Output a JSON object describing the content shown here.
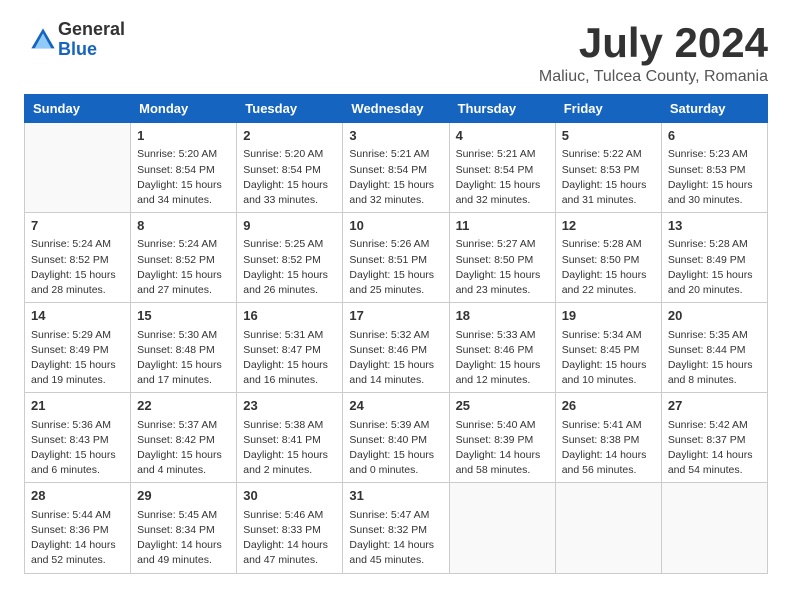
{
  "logo": {
    "general": "General",
    "blue": "Blue"
  },
  "title": "July 2024",
  "subtitle": "Maliuc, Tulcea County, Romania",
  "days_of_week": [
    "Sunday",
    "Monday",
    "Tuesday",
    "Wednesday",
    "Thursday",
    "Friday",
    "Saturday"
  ],
  "weeks": [
    [
      {
        "day": "",
        "sunrise": "",
        "sunset": "",
        "daylight": ""
      },
      {
        "day": "1",
        "sunrise": "Sunrise: 5:20 AM",
        "sunset": "Sunset: 8:54 PM",
        "daylight": "Daylight: 15 hours and 34 minutes."
      },
      {
        "day": "2",
        "sunrise": "Sunrise: 5:20 AM",
        "sunset": "Sunset: 8:54 PM",
        "daylight": "Daylight: 15 hours and 33 minutes."
      },
      {
        "day": "3",
        "sunrise": "Sunrise: 5:21 AM",
        "sunset": "Sunset: 8:54 PM",
        "daylight": "Daylight: 15 hours and 32 minutes."
      },
      {
        "day": "4",
        "sunrise": "Sunrise: 5:21 AM",
        "sunset": "Sunset: 8:54 PM",
        "daylight": "Daylight: 15 hours and 32 minutes."
      },
      {
        "day": "5",
        "sunrise": "Sunrise: 5:22 AM",
        "sunset": "Sunset: 8:53 PM",
        "daylight": "Daylight: 15 hours and 31 minutes."
      },
      {
        "day": "6",
        "sunrise": "Sunrise: 5:23 AM",
        "sunset": "Sunset: 8:53 PM",
        "daylight": "Daylight: 15 hours and 30 minutes."
      }
    ],
    [
      {
        "day": "7",
        "sunrise": "Sunrise: 5:24 AM",
        "sunset": "Sunset: 8:52 PM",
        "daylight": "Daylight: 15 hours and 28 minutes."
      },
      {
        "day": "8",
        "sunrise": "Sunrise: 5:24 AM",
        "sunset": "Sunset: 8:52 PM",
        "daylight": "Daylight: 15 hours and 27 minutes."
      },
      {
        "day": "9",
        "sunrise": "Sunrise: 5:25 AM",
        "sunset": "Sunset: 8:52 PM",
        "daylight": "Daylight: 15 hours and 26 minutes."
      },
      {
        "day": "10",
        "sunrise": "Sunrise: 5:26 AM",
        "sunset": "Sunset: 8:51 PM",
        "daylight": "Daylight: 15 hours and 25 minutes."
      },
      {
        "day": "11",
        "sunrise": "Sunrise: 5:27 AM",
        "sunset": "Sunset: 8:50 PM",
        "daylight": "Daylight: 15 hours and 23 minutes."
      },
      {
        "day": "12",
        "sunrise": "Sunrise: 5:28 AM",
        "sunset": "Sunset: 8:50 PM",
        "daylight": "Daylight: 15 hours and 22 minutes."
      },
      {
        "day": "13",
        "sunrise": "Sunrise: 5:28 AM",
        "sunset": "Sunset: 8:49 PM",
        "daylight": "Daylight: 15 hours and 20 minutes."
      }
    ],
    [
      {
        "day": "14",
        "sunrise": "Sunrise: 5:29 AM",
        "sunset": "Sunset: 8:49 PM",
        "daylight": "Daylight: 15 hours and 19 minutes."
      },
      {
        "day": "15",
        "sunrise": "Sunrise: 5:30 AM",
        "sunset": "Sunset: 8:48 PM",
        "daylight": "Daylight: 15 hours and 17 minutes."
      },
      {
        "day": "16",
        "sunrise": "Sunrise: 5:31 AM",
        "sunset": "Sunset: 8:47 PM",
        "daylight": "Daylight: 15 hours and 16 minutes."
      },
      {
        "day": "17",
        "sunrise": "Sunrise: 5:32 AM",
        "sunset": "Sunset: 8:46 PM",
        "daylight": "Daylight: 15 hours and 14 minutes."
      },
      {
        "day": "18",
        "sunrise": "Sunrise: 5:33 AM",
        "sunset": "Sunset: 8:46 PM",
        "daylight": "Daylight: 15 hours and 12 minutes."
      },
      {
        "day": "19",
        "sunrise": "Sunrise: 5:34 AM",
        "sunset": "Sunset: 8:45 PM",
        "daylight": "Daylight: 15 hours and 10 minutes."
      },
      {
        "day": "20",
        "sunrise": "Sunrise: 5:35 AM",
        "sunset": "Sunset: 8:44 PM",
        "daylight": "Daylight: 15 hours and 8 minutes."
      }
    ],
    [
      {
        "day": "21",
        "sunrise": "Sunrise: 5:36 AM",
        "sunset": "Sunset: 8:43 PM",
        "daylight": "Daylight: 15 hours and 6 minutes."
      },
      {
        "day": "22",
        "sunrise": "Sunrise: 5:37 AM",
        "sunset": "Sunset: 8:42 PM",
        "daylight": "Daylight: 15 hours and 4 minutes."
      },
      {
        "day": "23",
        "sunrise": "Sunrise: 5:38 AM",
        "sunset": "Sunset: 8:41 PM",
        "daylight": "Daylight: 15 hours and 2 minutes."
      },
      {
        "day": "24",
        "sunrise": "Sunrise: 5:39 AM",
        "sunset": "Sunset: 8:40 PM",
        "daylight": "Daylight: 15 hours and 0 minutes."
      },
      {
        "day": "25",
        "sunrise": "Sunrise: 5:40 AM",
        "sunset": "Sunset: 8:39 PM",
        "daylight": "Daylight: 14 hours and 58 minutes."
      },
      {
        "day": "26",
        "sunrise": "Sunrise: 5:41 AM",
        "sunset": "Sunset: 8:38 PM",
        "daylight": "Daylight: 14 hours and 56 minutes."
      },
      {
        "day": "27",
        "sunrise": "Sunrise: 5:42 AM",
        "sunset": "Sunset: 8:37 PM",
        "daylight": "Daylight: 14 hours and 54 minutes."
      }
    ],
    [
      {
        "day": "28",
        "sunrise": "Sunrise: 5:44 AM",
        "sunset": "Sunset: 8:36 PM",
        "daylight": "Daylight: 14 hours and 52 minutes."
      },
      {
        "day": "29",
        "sunrise": "Sunrise: 5:45 AM",
        "sunset": "Sunset: 8:34 PM",
        "daylight": "Daylight: 14 hours and 49 minutes."
      },
      {
        "day": "30",
        "sunrise": "Sunrise: 5:46 AM",
        "sunset": "Sunset: 8:33 PM",
        "daylight": "Daylight: 14 hours and 47 minutes."
      },
      {
        "day": "31",
        "sunrise": "Sunrise: 5:47 AM",
        "sunset": "Sunset: 8:32 PM",
        "daylight": "Daylight: 14 hours and 45 minutes."
      },
      {
        "day": "",
        "sunrise": "",
        "sunset": "",
        "daylight": ""
      },
      {
        "day": "",
        "sunrise": "",
        "sunset": "",
        "daylight": ""
      },
      {
        "day": "",
        "sunrise": "",
        "sunset": "",
        "daylight": ""
      }
    ]
  ]
}
